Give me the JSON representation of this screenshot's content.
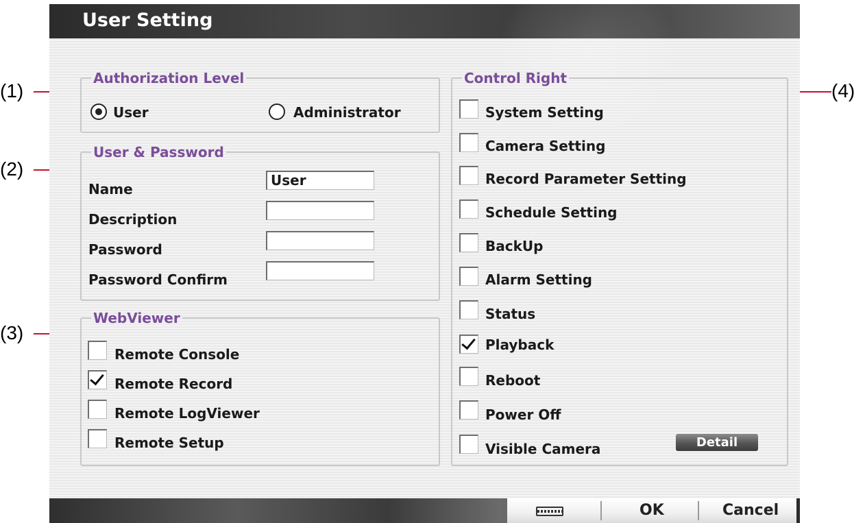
{
  "dialog": {
    "title": "User Setting"
  },
  "callouts": [
    "(1)",
    "(2)",
    "(3)",
    "(4)"
  ],
  "authorization": {
    "legend": "Authorization Level",
    "options": [
      {
        "label": "User",
        "selected": true
      },
      {
        "label": "Administrator",
        "selected": false
      }
    ]
  },
  "user_password": {
    "legend": "User & Password",
    "fields": [
      {
        "label": "Name",
        "value": "User"
      },
      {
        "label": "Description",
        "value": ""
      },
      {
        "label": "Password",
        "value": ""
      },
      {
        "label": "Password Confirm",
        "value": ""
      }
    ]
  },
  "webviewer": {
    "legend": "WebViewer",
    "items": [
      {
        "label": "Remote Console",
        "checked": false
      },
      {
        "label": "Remote Record",
        "checked": true
      },
      {
        "label": "Remote LogViewer",
        "checked": false
      },
      {
        "label": "Remote Setup",
        "checked": false
      }
    ]
  },
  "control_right": {
    "legend": "Control Right",
    "items": [
      {
        "label": "System Setting",
        "checked": false
      },
      {
        "label": "Camera Setting",
        "checked": false
      },
      {
        "label": "Record Parameter Setting",
        "checked": false
      },
      {
        "label": "Schedule Setting",
        "checked": false
      },
      {
        "label": "BackUp",
        "checked": false
      },
      {
        "label": "Alarm Setting",
        "checked": false
      },
      {
        "label": "Status",
        "checked": false
      },
      {
        "label": "Playback",
        "checked": true
      },
      {
        "label": "Reboot",
        "checked": false
      },
      {
        "label": "Power Off",
        "checked": false
      },
      {
        "label": "Visible Camera",
        "checked": false
      }
    ],
    "detail_label": "Detail"
  },
  "buttons": {
    "keyboard_icon": "keyboard-icon",
    "ok": "OK",
    "cancel": "Cancel"
  },
  "colors": {
    "legend": "#7a4d9a",
    "callout_line": "#c8102e"
  }
}
